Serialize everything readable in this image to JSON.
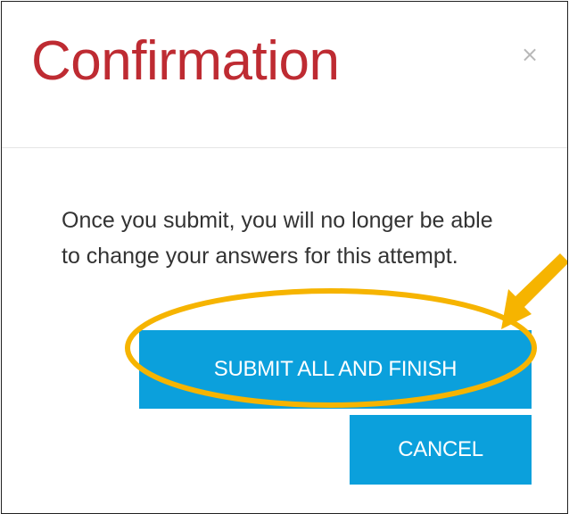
{
  "dialog": {
    "title": "Confirmation",
    "close_symbol": "×",
    "message": "Once you submit, you will no longer be able to change your answers for this attempt.",
    "submit_label": "SUBMIT ALL AND FINISH",
    "cancel_label": "CANCEL"
  },
  "icons": {
    "close": "close-icon",
    "annotation_arrow": "arrow-pointer-icon"
  },
  "colors": {
    "title": "#be2b32",
    "button_bg": "#0ba0dc",
    "button_text": "#ffffff",
    "annotation": "#f6b400",
    "body_text": "#333333"
  }
}
